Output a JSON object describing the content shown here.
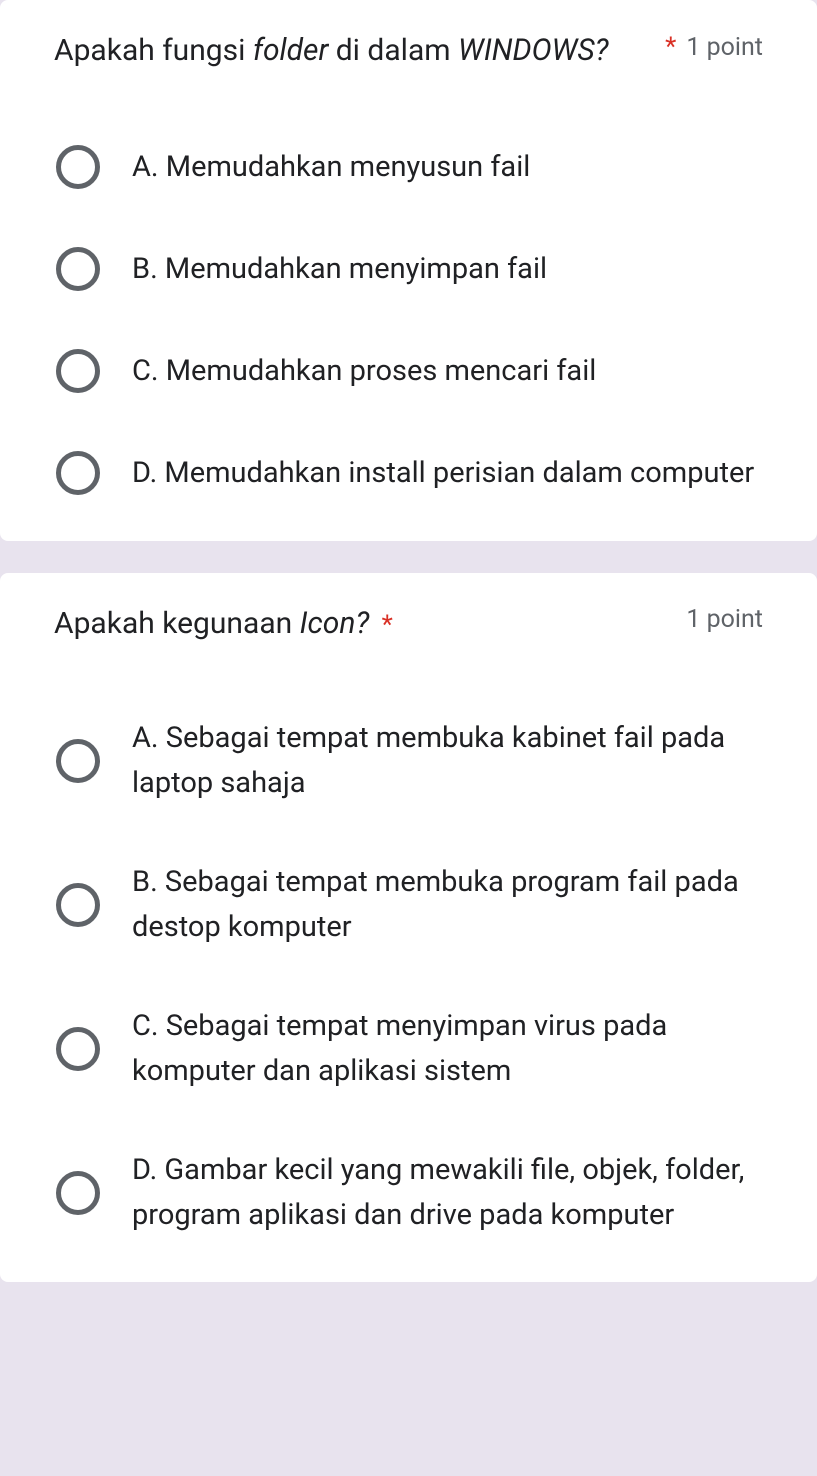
{
  "questions": [
    {
      "title_prefix": "Apakah fungsi ",
      "title_italic1": "folder",
      "title_mid": " di dalam ",
      "title_italic2": "WINDOWS?",
      "points": "1 point",
      "required_outside": true,
      "options": [
        "A. Memudahkan menyusun fail",
        "B. Memudahkan menyimpan fail",
        "C. Memudahkan proses mencari fail",
        "D. Memudahkan install perisian dalam computer"
      ]
    },
    {
      "title_prefix": "Apakah kegunaan ",
      "title_italic1": "Icon?",
      "title_mid": "",
      "title_italic2": "",
      "points": "1 point",
      "required_outside": false,
      "options": [
        "A. Sebagai tempat membuka kabinet fail pada laptop sahaja",
        "B. Sebagai tempat membuka program fail pada destop komputer",
        "C. Sebagai tempat menyimpan virus pada komputer dan aplikasi sistem",
        "D. Gambar kecil yang mewakili file, objek, folder, program aplikasi dan drive pada komputer"
      ]
    }
  ]
}
